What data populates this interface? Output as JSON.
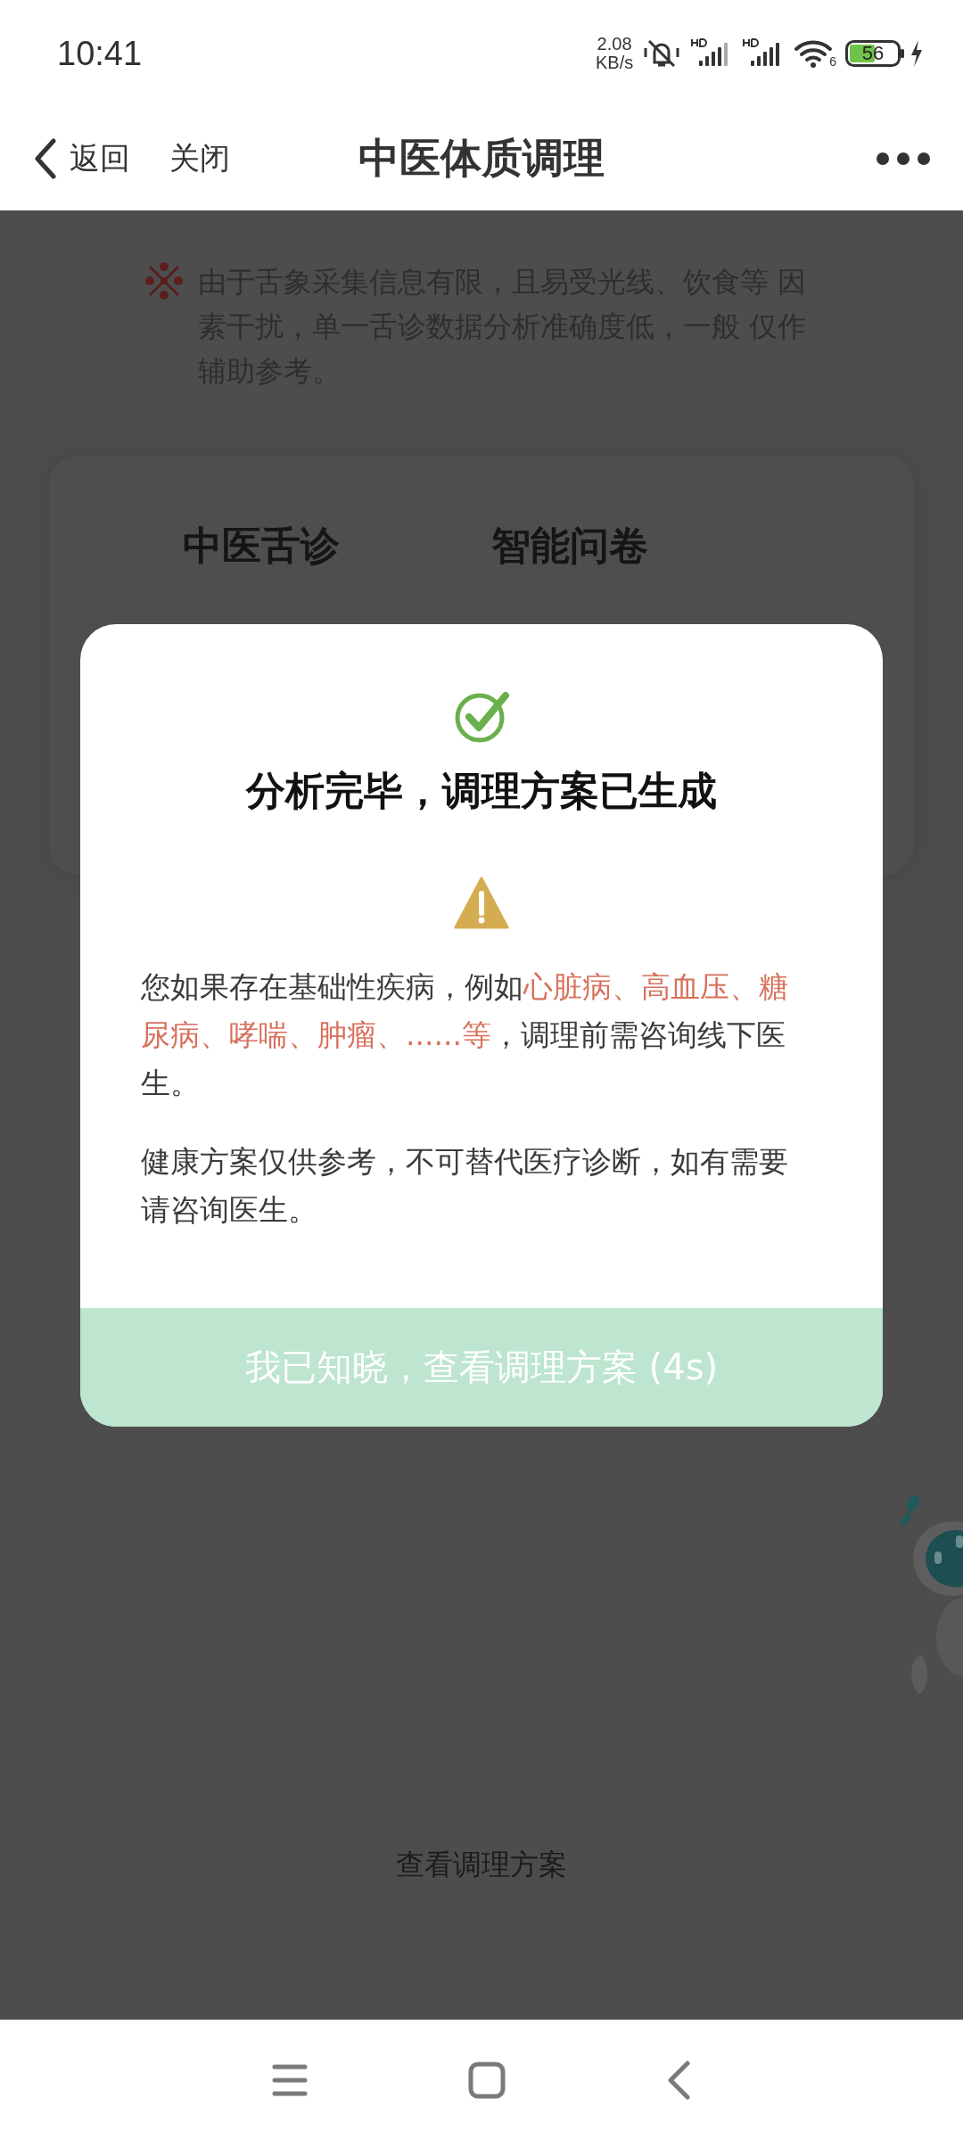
{
  "status_bar": {
    "time": "10:41",
    "net_speed": "2.08",
    "net_unit": "KB/s",
    "wifi_badge": "6",
    "battery": "56"
  },
  "header": {
    "back": "返回",
    "close": "关闭",
    "title": "中医体质调理"
  },
  "notice": "由于舌象采集信息有限，且易受光线、饮食等 因素干扰，单一舌诊数据分析准确度低，一般 仅作辅助参考。",
  "tabs": [
    "中医舌诊",
    "智能问卷"
  ],
  "footer_link": "查看调理方案",
  "dialog": {
    "title": "分析完毕，调理方案已生成",
    "warning": [
      {
        "text": "您如果存在基础性疾病，例如",
        "kind": "plain"
      },
      {
        "text": "心脏病、高血压、糖尿病、哮喘、肿瘤、......等",
        "kind": "highlight"
      },
      {
        "text": "，调理前需咨询线下医生。",
        "kind": "plain"
      }
    ],
    "note": "健康方案仅供参考，不可替代医疗诊断，如有需要请咨询医生。",
    "button": "我已知晓，查看调理方案 (4s)"
  }
}
